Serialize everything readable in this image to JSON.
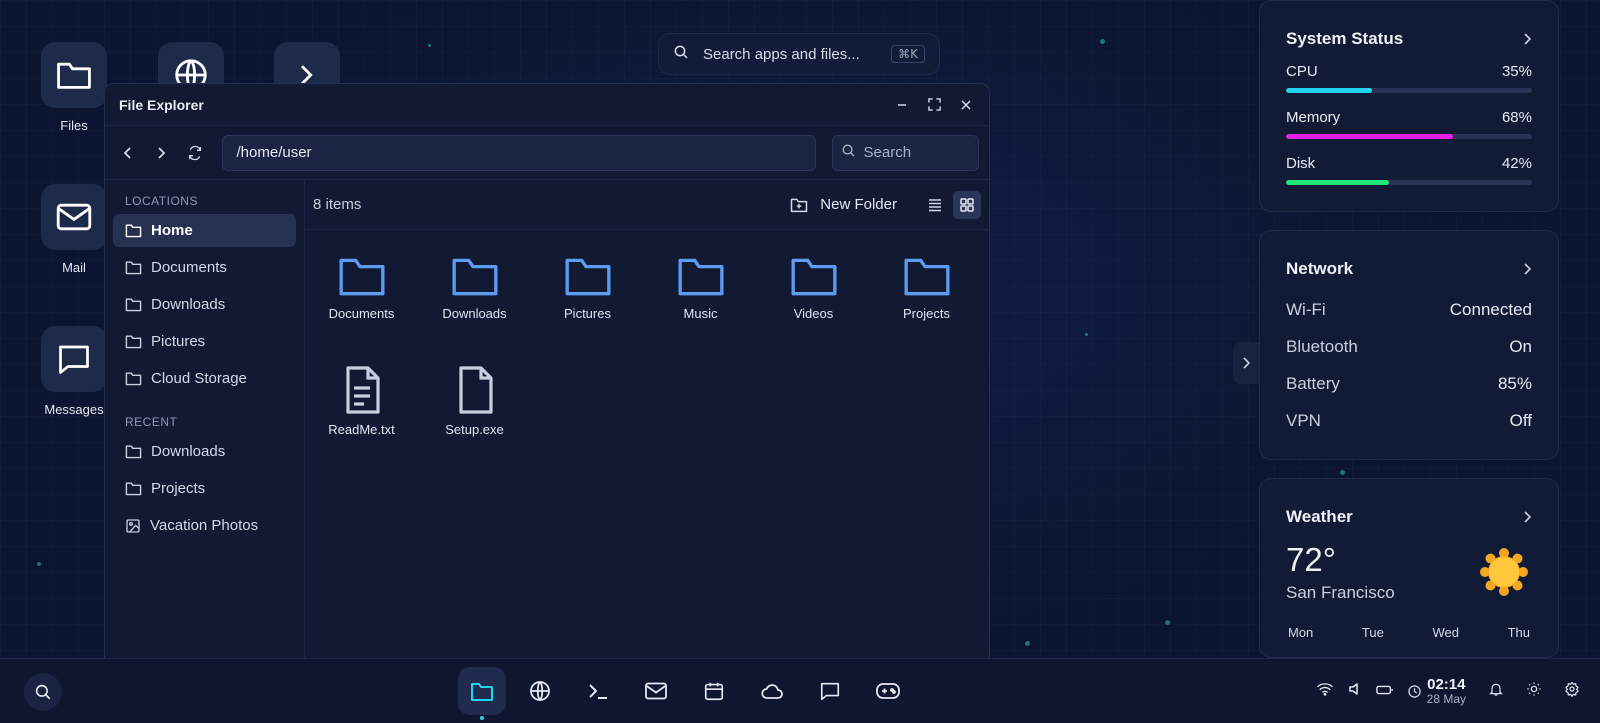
{
  "desktop": {
    "icons": [
      {
        "label": "Files",
        "icon": "folder-icon"
      },
      {
        "label": "",
        "icon": "globe-icon"
      },
      {
        "label": "",
        "icon": "terminal-icon"
      },
      {
        "label": "Mail",
        "icon": "mail-icon"
      },
      {
        "label": "Messages",
        "icon": "message-icon"
      }
    ],
    "search": {
      "placeholder": "Search apps and files...",
      "shortcut": "⌘K"
    }
  },
  "window": {
    "title": "File Explorer",
    "path": "/home/user",
    "search_placeholder": "Search",
    "sidebar": {
      "locations_label": "LOCATIONS",
      "locations": [
        "Home",
        "Documents",
        "Downloads",
        "Pictures",
        "Cloud Storage"
      ],
      "recent_label": "RECENT",
      "recent": [
        "Downloads",
        "Projects",
        "Vacation Photos"
      ]
    },
    "item_count": "8 items",
    "new_folder_label": "New Folder",
    "files": [
      {
        "name": "Documents",
        "type": "folder"
      },
      {
        "name": "Downloads",
        "type": "folder"
      },
      {
        "name": "Pictures",
        "type": "folder"
      },
      {
        "name": "Music",
        "type": "folder"
      },
      {
        "name": "Videos",
        "type": "folder"
      },
      {
        "name": "Projects",
        "type": "folder"
      },
      {
        "name": "ReadMe.txt",
        "type": "text-file"
      },
      {
        "name": "Setup.exe",
        "type": "file"
      }
    ]
  },
  "widgets": {
    "system": {
      "title": "System Status",
      "stats": [
        {
          "label": "CPU",
          "value": "35%",
          "fraction": 0.35,
          "color": "#22d3ee"
        },
        {
          "label": "Memory",
          "value": "68%",
          "fraction": 0.68,
          "color": "#e61ee6"
        },
        {
          "label": "Disk",
          "value": "42%",
          "fraction": 0.42,
          "color": "#22e57a"
        }
      ]
    },
    "network": {
      "title": "Network",
      "rows": [
        {
          "label": "Wi-Fi",
          "value": "Connected"
        },
        {
          "label": "Bluetooth",
          "value": "On"
        },
        {
          "label": "Battery",
          "value": "85%"
        },
        {
          "label": "VPN",
          "value": "Off"
        }
      ]
    },
    "weather": {
      "title": "Weather",
      "temp": "72°",
      "city": "San Francisco",
      "days": [
        "Mon",
        "Tue",
        "Wed",
        "Thu"
      ]
    }
  },
  "taskbar": {
    "apps": [
      "folder-icon",
      "globe-icon",
      "terminal-icon",
      "mail-icon",
      "calendar-icon",
      "cloud-icon",
      "message-icon",
      "gamepad-icon"
    ],
    "time": "02:14",
    "date": "28 May"
  },
  "colors": {
    "accent": "#22d3ee",
    "folder": "#5b9cf0",
    "sun": "#f5a623"
  }
}
